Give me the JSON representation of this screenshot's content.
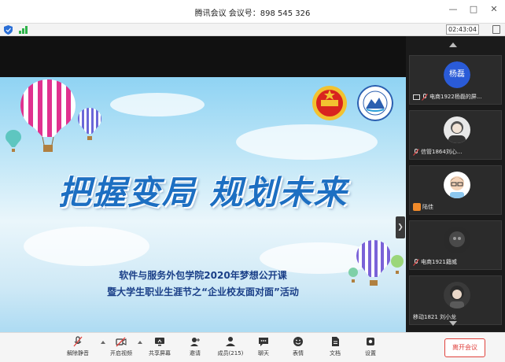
{
  "window": {
    "title": "腾讯会议 会议号：898 545 326"
  },
  "status": {
    "timer": "02:43:04"
  },
  "slide": {
    "title": "把握变局 规划未来",
    "subtitle1": "软件与服务外包学院2020年梦想公开课",
    "subtitle2": "暨大学生职业生涯节之“企业校友面对面”活动"
  },
  "participants": [
    {
      "name": "电商1922杨磊的屏...",
      "avatar_text": "杨磊",
      "icon": "screen-share-icon"
    },
    {
      "name": "信管1864刘心...",
      "avatar_text": "",
      "icon": "mic-muted-icon"
    },
    {
      "name": "陆佳",
      "avatar_text": "",
      "icon": "user-icon"
    },
    {
      "name": "电商1921籍威",
      "avatar_text": "",
      "icon": "mic-muted-icon"
    },
    {
      "name": "移动1821 刘小龙",
      "avatar_text": "",
      "icon": ""
    }
  ],
  "toolbar": {
    "mute": "解除静音",
    "video": "开启视频",
    "share": "共享屏幕",
    "invite": "邀请",
    "members": "成员(215)",
    "chat": "聊天",
    "emoji": "表情",
    "docs": "文档",
    "settings": "设置",
    "leave": "离开会议"
  },
  "colors": {
    "accent": "#2a5bd7",
    "danger": "#e0413c",
    "slide_title": "#1d6fc2"
  }
}
